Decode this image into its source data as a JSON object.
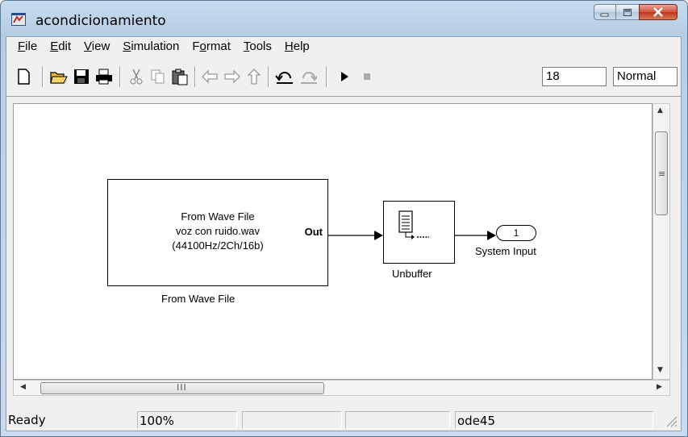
{
  "window": {
    "title": "acondicionamiento",
    "caption_buttons": [
      "minimize-icon",
      "maximize-icon",
      "close-icon"
    ]
  },
  "menu": [
    {
      "label": "File",
      "accel": "F"
    },
    {
      "label": "Edit",
      "accel": "E"
    },
    {
      "label": "View",
      "accel": "V"
    },
    {
      "label": "Simulation",
      "accel": "S"
    },
    {
      "label": "Format",
      "accel": "o"
    },
    {
      "label": "Tools",
      "accel": "T"
    },
    {
      "label": "Help",
      "accel": "H"
    }
  ],
  "toolbar": {
    "icons": [
      "new-icon",
      "open-icon",
      "save-icon",
      "print-icon",
      "cut-icon",
      "copy-icon",
      "paste-icon",
      "back-icon",
      "forward-icon",
      "up-icon",
      "undo-icon",
      "redo-icon",
      "start-icon",
      "stop-icon"
    ],
    "stop_time": "18",
    "sim_mode": "Normal"
  },
  "model": {
    "wave_block": {
      "line1": "From Wave File",
      "line2": "voz con ruido.wav",
      "line3": "(44100Hz/2Ch/16b)",
      "port": "Out",
      "name": "From Wave File"
    },
    "unbuffer_block": {
      "name": "Unbuffer"
    },
    "outport": {
      "number": "1",
      "name": "System Input"
    }
  },
  "statusbar": {
    "status": "Ready",
    "zoom": "100%",
    "cell3": "",
    "cell4": "",
    "solver": "ode45"
  }
}
